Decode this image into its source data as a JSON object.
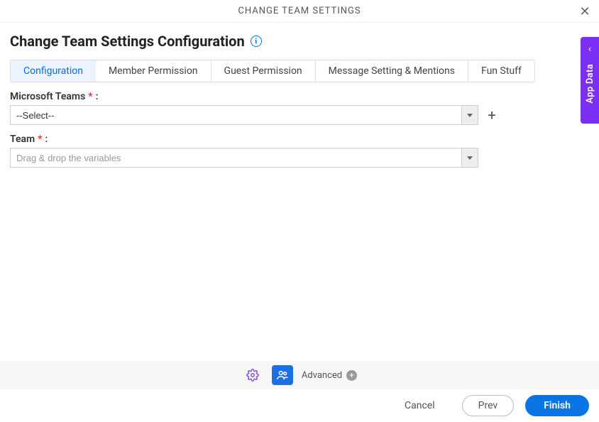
{
  "header": {
    "title": "CHANGE TEAM SETTINGS"
  },
  "page": {
    "title": "Change Team Settings Configuration"
  },
  "tabs": [
    {
      "label": "Configuration",
      "active": true
    },
    {
      "label": "Member Permission",
      "active": false
    },
    {
      "label": "Guest Permission",
      "active": false
    },
    {
      "label": "Message Setting & Mentions",
      "active": false
    },
    {
      "label": "Fun Stuff",
      "active": false
    }
  ],
  "fields": {
    "msteams": {
      "label": "Microsoft Teams",
      "required": "*",
      "colon": ":",
      "value": "--Select--",
      "placeholder": ""
    },
    "team": {
      "label": "Team",
      "required": "*",
      "colon": ":",
      "value": "",
      "placeholder": "Drag & drop the variables"
    }
  },
  "toolbar": {
    "advanced": "Advanced"
  },
  "footer": {
    "cancel": "Cancel",
    "prev": "Prev",
    "finish": "Finish"
  },
  "side": {
    "label": "App Data"
  }
}
